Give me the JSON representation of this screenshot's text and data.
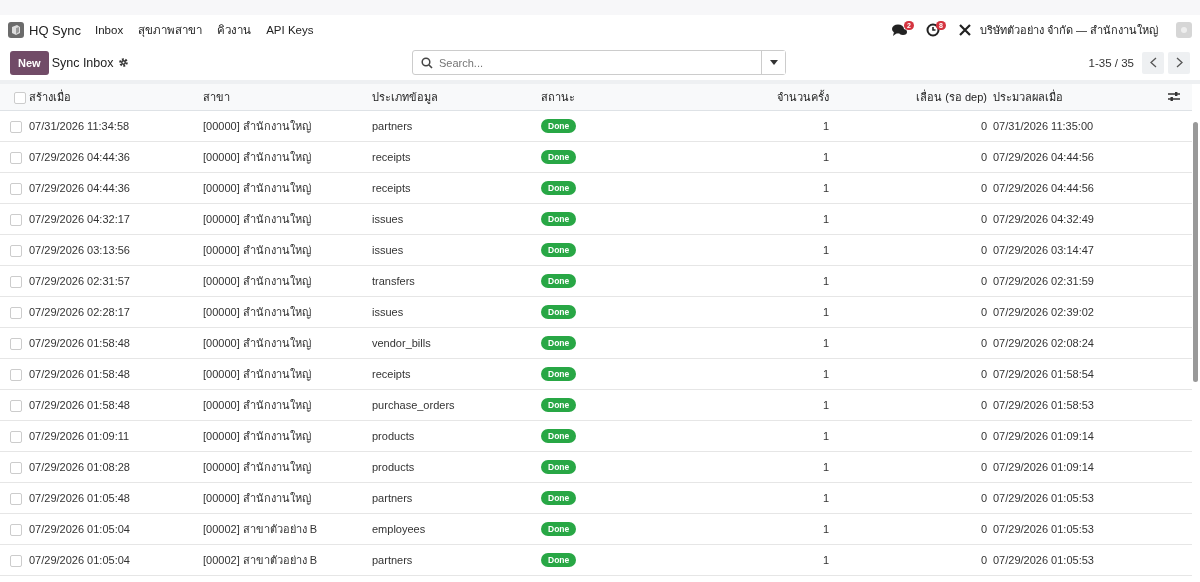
{
  "app": {
    "name": "HQ Sync"
  },
  "nav": [
    {
      "label": "Inbox"
    },
    {
      "label": "สุขภาพสาขา"
    },
    {
      "label": "คิวงาน"
    },
    {
      "label": "API Keys"
    }
  ],
  "systray": {
    "messages_count": "2",
    "activities_count": "8",
    "company": "บริษัทตัวอย่าง จำกัด — สำนักงานใหญ่"
  },
  "control_panel": {
    "new_button": "New",
    "title": "Sync Inbox",
    "search_placeholder": "Search...",
    "pager": "1-35 / 35"
  },
  "table": {
    "select_all_checked": false,
    "columns": [
      {
        "label": "สร้างเมื่อ"
      },
      {
        "label": "สาขา"
      },
      {
        "label": "ประเภทข้อมูล"
      },
      {
        "label": "สถานะ"
      },
      {
        "label": "จำนวนครั้ง"
      },
      {
        "label": "เลื่อน (รอ dep)"
      },
      {
        "label": "ประมวลผลเมื่อ"
      }
    ],
    "rows": [
      {
        "checked": false,
        "created": "07/31/2026 11:34:58",
        "branch": "[00000] สำนักงานใหญ่",
        "type": "partners",
        "status": "Done",
        "attempts": "1",
        "deferred": "0",
        "processed": "07/31/2026 11:35:00"
      },
      {
        "checked": false,
        "created": "07/29/2026 04:44:36",
        "branch": "[00000] สำนักงานใหญ่",
        "type": "receipts",
        "status": "Done",
        "attempts": "1",
        "deferred": "0",
        "processed": "07/29/2026 04:44:56"
      },
      {
        "checked": false,
        "created": "07/29/2026 04:44:36",
        "branch": "[00000] สำนักงานใหญ่",
        "type": "receipts",
        "status": "Done",
        "attempts": "1",
        "deferred": "0",
        "processed": "07/29/2026 04:44:56"
      },
      {
        "checked": false,
        "created": "07/29/2026 04:32:17",
        "branch": "[00000] สำนักงานใหญ่",
        "type": "issues",
        "status": "Done",
        "attempts": "1",
        "deferred": "0",
        "processed": "07/29/2026 04:32:49"
      },
      {
        "checked": false,
        "created": "07/29/2026 03:13:56",
        "branch": "[00000] สำนักงานใหญ่",
        "type": "issues",
        "status": "Done",
        "attempts": "1",
        "deferred": "0",
        "processed": "07/29/2026 03:14:47"
      },
      {
        "checked": false,
        "created": "07/29/2026 02:31:57",
        "branch": "[00000] สำนักงานใหญ่",
        "type": "transfers",
        "status": "Done",
        "attempts": "1",
        "deferred": "0",
        "processed": "07/29/2026 02:31:59"
      },
      {
        "checked": false,
        "created": "07/29/2026 02:28:17",
        "branch": "[00000] สำนักงานใหญ่",
        "type": "issues",
        "status": "Done",
        "attempts": "1",
        "deferred": "0",
        "processed": "07/29/2026 02:39:02"
      },
      {
        "checked": false,
        "created": "07/29/2026 01:58:48",
        "branch": "[00000] สำนักงานใหญ่",
        "type": "vendor_bills",
        "status": "Done",
        "attempts": "1",
        "deferred": "0",
        "processed": "07/29/2026 02:08:24"
      },
      {
        "checked": false,
        "created": "07/29/2026 01:58:48",
        "branch": "[00000] สำนักงานใหญ่",
        "type": "receipts",
        "status": "Done",
        "attempts": "1",
        "deferred": "0",
        "processed": "07/29/2026 01:58:54"
      },
      {
        "checked": false,
        "created": "07/29/2026 01:58:48",
        "branch": "[00000] สำนักงานใหญ่",
        "type": "purchase_orders",
        "status": "Done",
        "attempts": "1",
        "deferred": "0",
        "processed": "07/29/2026 01:58:53"
      },
      {
        "checked": false,
        "created": "07/29/2026 01:09:11",
        "branch": "[00000] สำนักงานใหญ่",
        "type": "products",
        "status": "Done",
        "attempts": "1",
        "deferred": "0",
        "processed": "07/29/2026 01:09:14"
      },
      {
        "checked": false,
        "created": "07/29/2026 01:08:28",
        "branch": "[00000] สำนักงานใหญ่",
        "type": "products",
        "status": "Done",
        "attempts": "1",
        "deferred": "0",
        "processed": "07/29/2026 01:09:14"
      },
      {
        "checked": false,
        "created": "07/29/2026 01:05:48",
        "branch": "[00000] สำนักงานใหญ่",
        "type": "partners",
        "status": "Done",
        "attempts": "1",
        "deferred": "0",
        "processed": "07/29/2026 01:05:53"
      },
      {
        "checked": false,
        "created": "07/29/2026 01:05:04",
        "branch": "[00002] สาขาตัวอย่าง B",
        "type": "employees",
        "status": "Done",
        "attempts": "1",
        "deferred": "0",
        "processed": "07/29/2026 01:05:53"
      },
      {
        "checked": false,
        "created": "07/29/2026 01:05:04",
        "branch": "[00002] สาขาตัวอย่าง B",
        "type": "partners",
        "status": "Done",
        "attempts": "1",
        "deferred": "0",
        "processed": "07/29/2026 01:05:53"
      }
    ]
  }
}
